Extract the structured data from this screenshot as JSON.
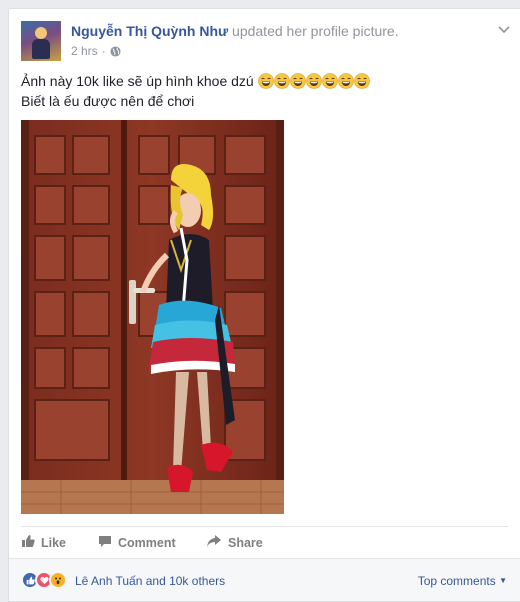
{
  "post": {
    "author_name": "Nguyễn Thị Quỳnh Như",
    "action": "updated her profile picture.",
    "time": "2 hrs",
    "separator": "·",
    "privacy_icon": "globe-icon",
    "menu_icon": "chevron-down-icon"
  },
  "body": {
    "line1": "Ảnh này 10k like sẽ úp hình khoe dzú",
    "line2": "Biết là ếu được nên để chơi",
    "emoji_count": 7,
    "emoji_icon": "laughing-emoji-icon"
  },
  "actions": {
    "like": "Like",
    "comment": "Comment",
    "share": "Share"
  },
  "reactions": {
    "summary": "Lê Anh Tuấn and 10k others",
    "top_comments": "Top comments",
    "types": [
      "like",
      "love",
      "wow"
    ]
  },
  "colors": {
    "link": "#365899",
    "meta": "#90949c",
    "like_blue": "#4267b2",
    "love_red": "#f25268",
    "wow_yellow": "#f7b125"
  }
}
